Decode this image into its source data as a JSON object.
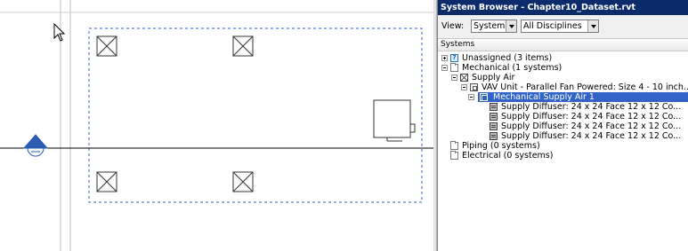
{
  "browser": {
    "title": "System Browser - Chapter10_Dataset.rvt",
    "view_label": "View:",
    "view_value": "Systems",
    "discipline_value": "All Disciplines",
    "column_header": "Systems",
    "tree": [
      {
        "label": "Unassigned (3 items)",
        "icon": "unknown",
        "level": 0,
        "expander": "plus"
      },
      {
        "label": "Mechanical (1 systems)",
        "icon": "folder",
        "level": 0,
        "expander": "minus"
      },
      {
        "label": "Supply Air",
        "icon": "xbox",
        "level": 1,
        "expander": "minus"
      },
      {
        "label": "VAV Unit - Parallel Fan Powered: Size 4 - 10 inch...",
        "icon": "equip",
        "level": 2,
        "expander": "minus"
      },
      {
        "label": "Mechanical Supply Air 1",
        "icon": "sys",
        "level": 3,
        "expander": "minus",
        "selected": true
      },
      {
        "label": "Supply Diffuser: 24 x 24 Face 12 x 12 Co...",
        "icon": "diff",
        "level": 4,
        "expander": "none"
      },
      {
        "label": "Supply Diffuser: 24 x 24 Face 12 x 12 Co...",
        "icon": "diff",
        "level": 4,
        "expander": "none"
      },
      {
        "label": "Supply Diffuser: 24 x 24 Face 12 x 12 Co...",
        "icon": "diff",
        "level": 4,
        "expander": "none"
      },
      {
        "label": "Supply Diffuser: 24 x 24 Face 12 x 12 Co...",
        "icon": "diff",
        "level": 4,
        "expander": "none"
      },
      {
        "label": "Piping (0 systems)",
        "icon": "folder",
        "level": 0,
        "expander": "none"
      },
      {
        "label": "Electrical (0 systems)",
        "icon": "folder",
        "level": 0,
        "expander": "none"
      }
    ]
  },
  "canvas": {
    "colors": {
      "selection": "#3a5fcd",
      "level_marker": "#2a5db0",
      "linework": "#000000"
    }
  }
}
